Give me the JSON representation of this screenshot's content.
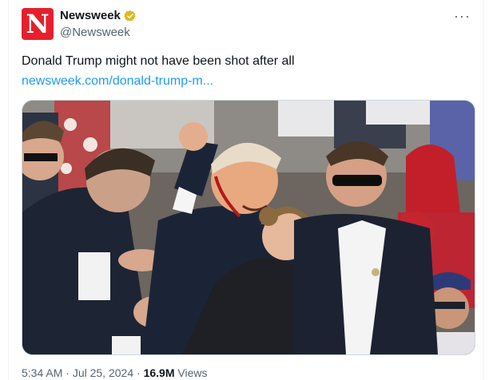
{
  "account": {
    "display_name": "Newsweek",
    "handle": "@Newsweek",
    "avatar_letter": "N",
    "brand_color": "#e4202d",
    "verified_color": "#e2b719"
  },
  "menu": {
    "more_label": "···"
  },
  "tweet": {
    "text": "Donald Trump might not have been shot after all",
    "link": "newsweek.com/donald-trump-m..."
  },
  "media": {
    "kind": "photo"
  },
  "meta": {
    "time": "5:34 AM",
    "separator": "·",
    "date": "Jul 25, 2024",
    "views_count": "16.9M",
    "views_label": "Views"
  },
  "colors": {
    "text": "#0f1419",
    "muted": "#536471",
    "link": "#1d9bf0"
  }
}
